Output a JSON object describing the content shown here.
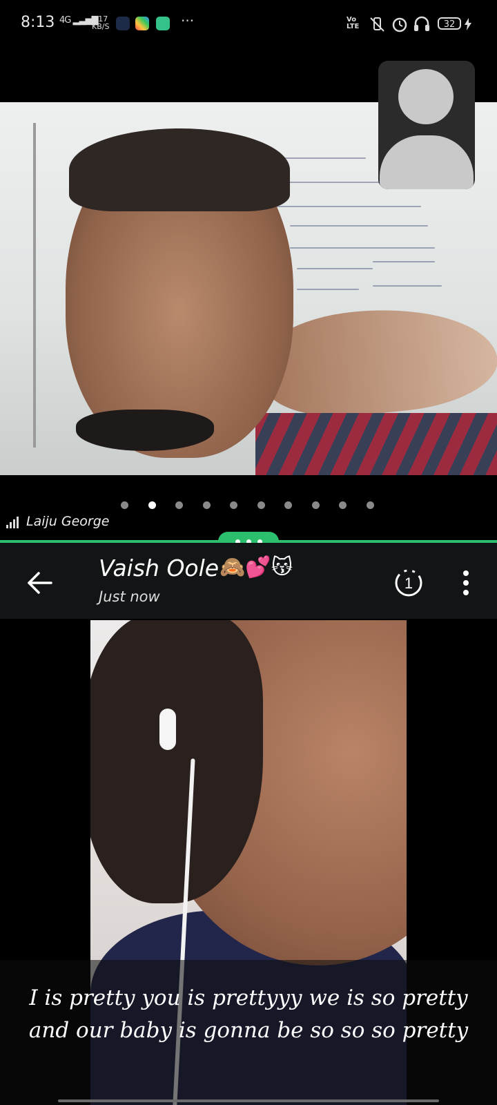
{
  "status_bar": {
    "time": "8:13",
    "network": "4G",
    "speed_value": "117",
    "speed_unit": "KB/S",
    "volte": "Vo LTE",
    "battery": "32",
    "more": "···"
  },
  "call": {
    "participant_name": "Laiju George",
    "pager_count": 10,
    "pager_active_index": 1
  },
  "status": {
    "contact_name": "Vaish Oole",
    "contact_emojis": "🙈💕😽",
    "time_ago": "Just now",
    "timer_label": "1",
    "caption": "I is pretty you is prettyyy we is so pretty and our baby is gonna be so so so pretty"
  },
  "colors": {
    "accent_green": "#2bbf6e",
    "header_bg": "#121516"
  }
}
